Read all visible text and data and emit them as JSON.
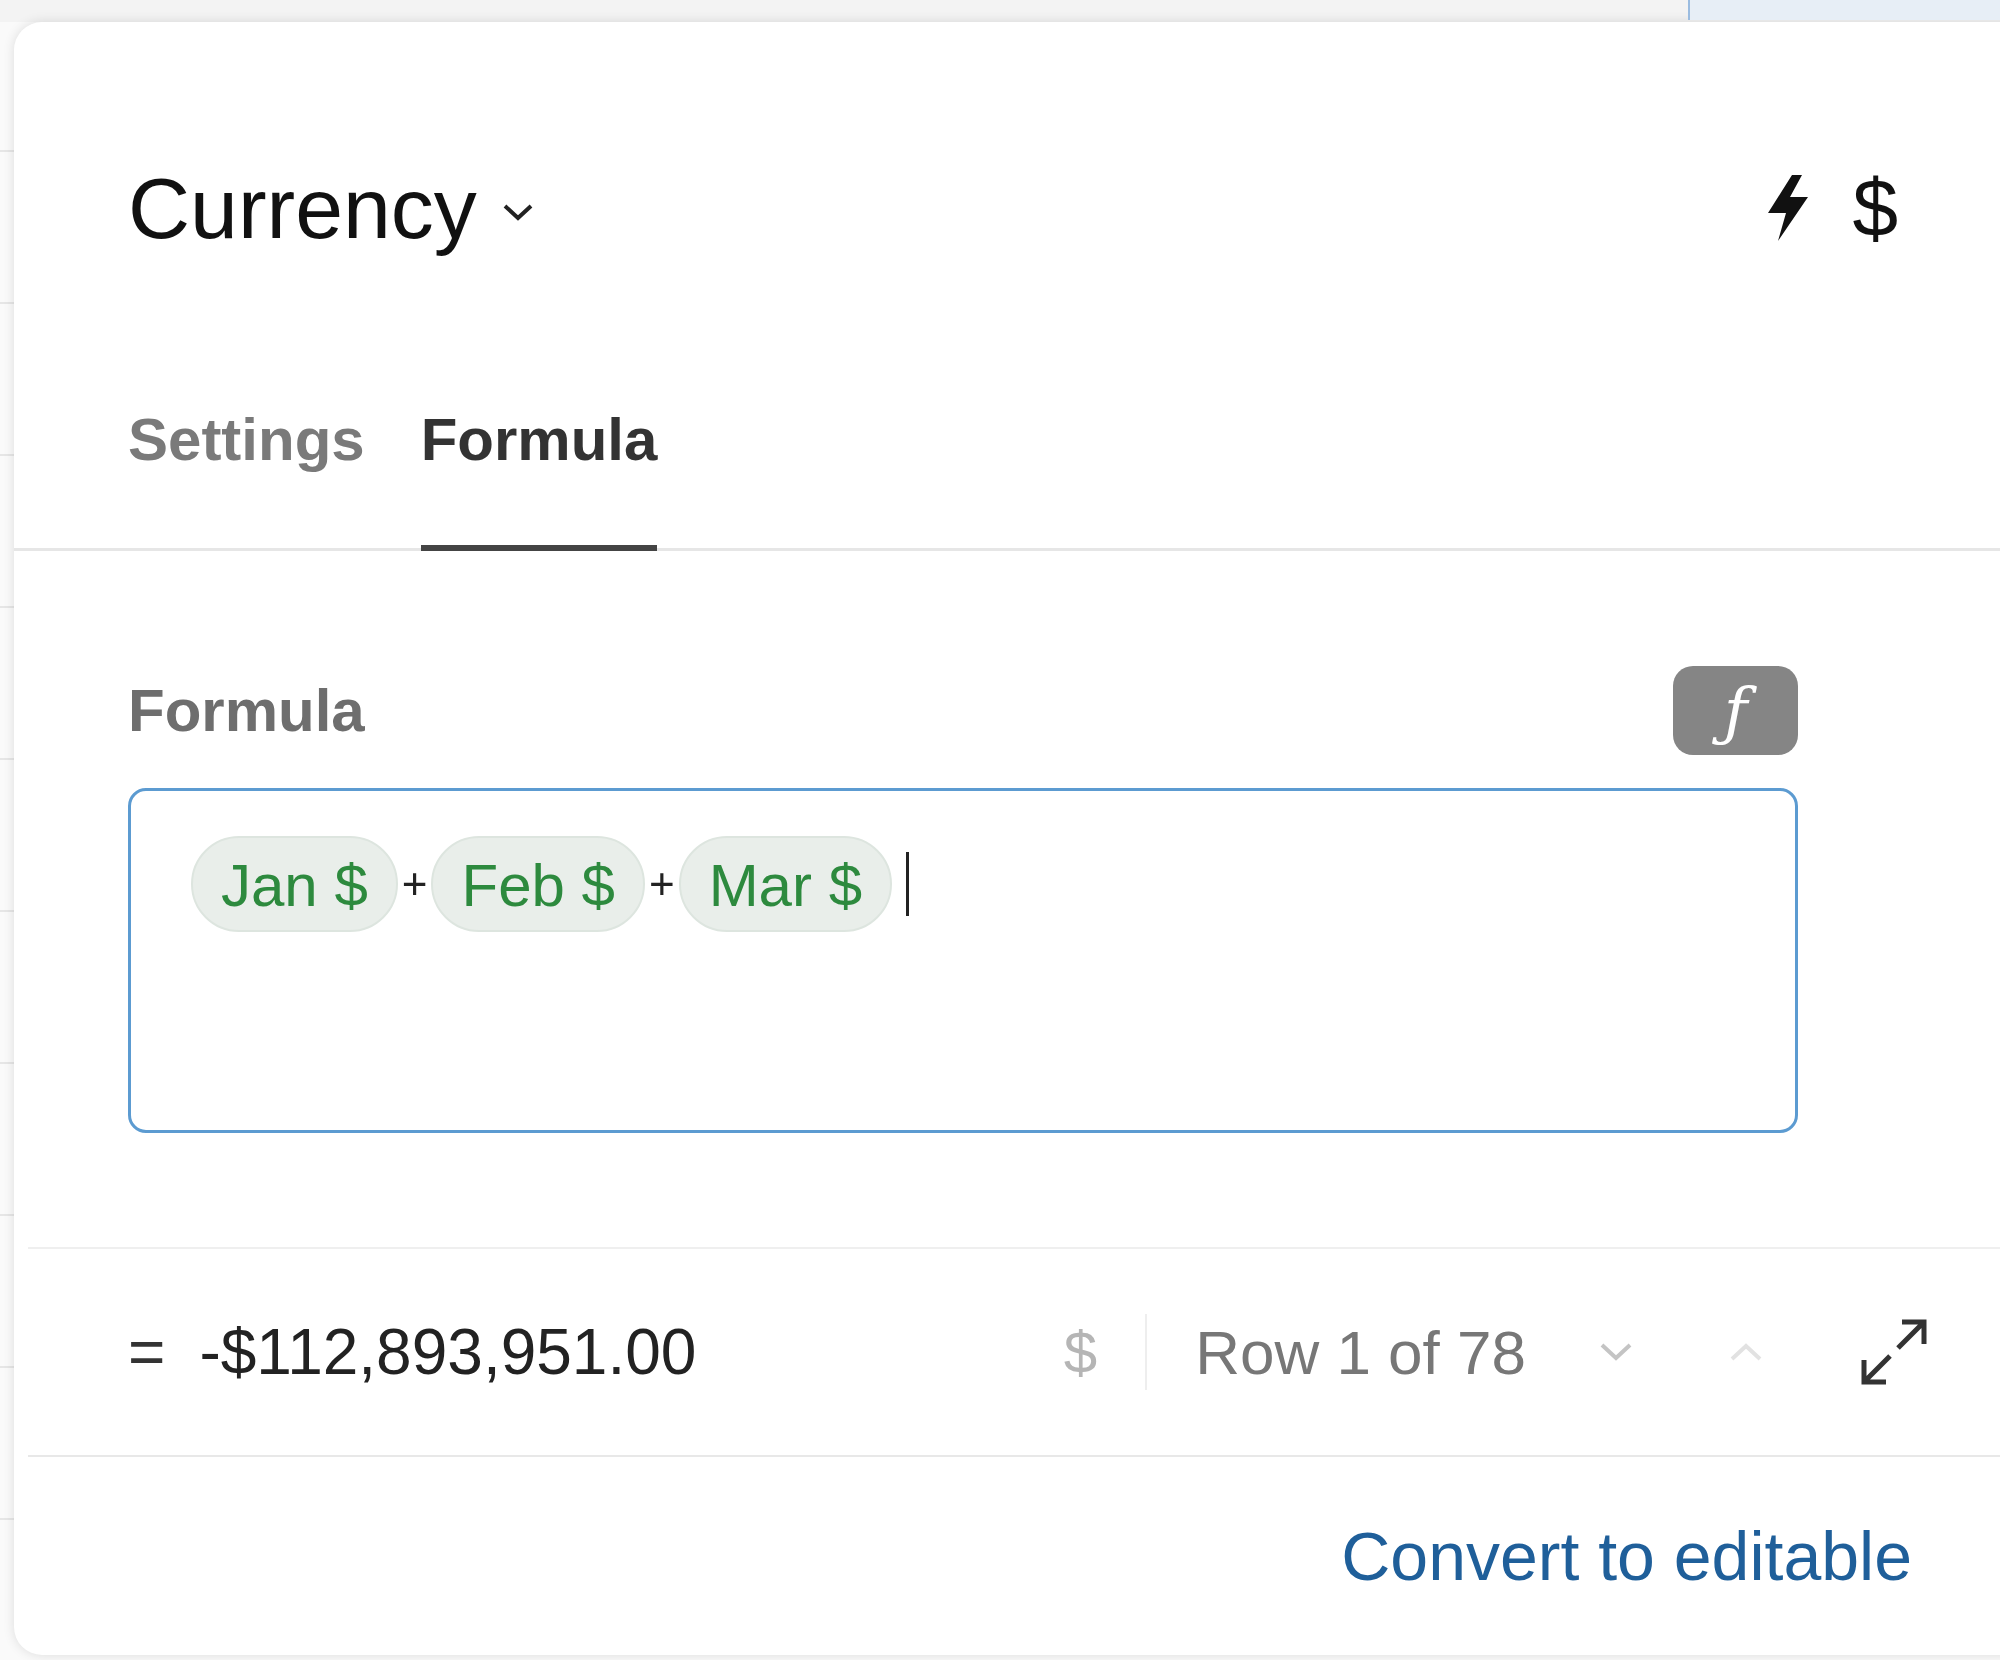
{
  "header": {
    "title": "Currency",
    "type_symbol": "$"
  },
  "tabs": [
    {
      "label": "Settings",
      "selected": false
    },
    {
      "label": "Formula",
      "selected": true
    }
  ],
  "formula": {
    "label": "Formula",
    "function_button": "ƒ",
    "focused": true,
    "tokens": [
      {
        "kind": "field",
        "text": "Jan $"
      },
      {
        "kind": "operator",
        "text": "+"
      },
      {
        "kind": "field",
        "text": "Feb $"
      },
      {
        "kind": "operator",
        "text": "+"
      },
      {
        "kind": "field",
        "text": "Mar $"
      }
    ]
  },
  "result": {
    "prefix": "=",
    "value": "-$112,893,951.00",
    "format_symbol": "$",
    "row_indicator": "Row 1 of 78"
  },
  "footer": {
    "link": "Convert to editable"
  }
}
